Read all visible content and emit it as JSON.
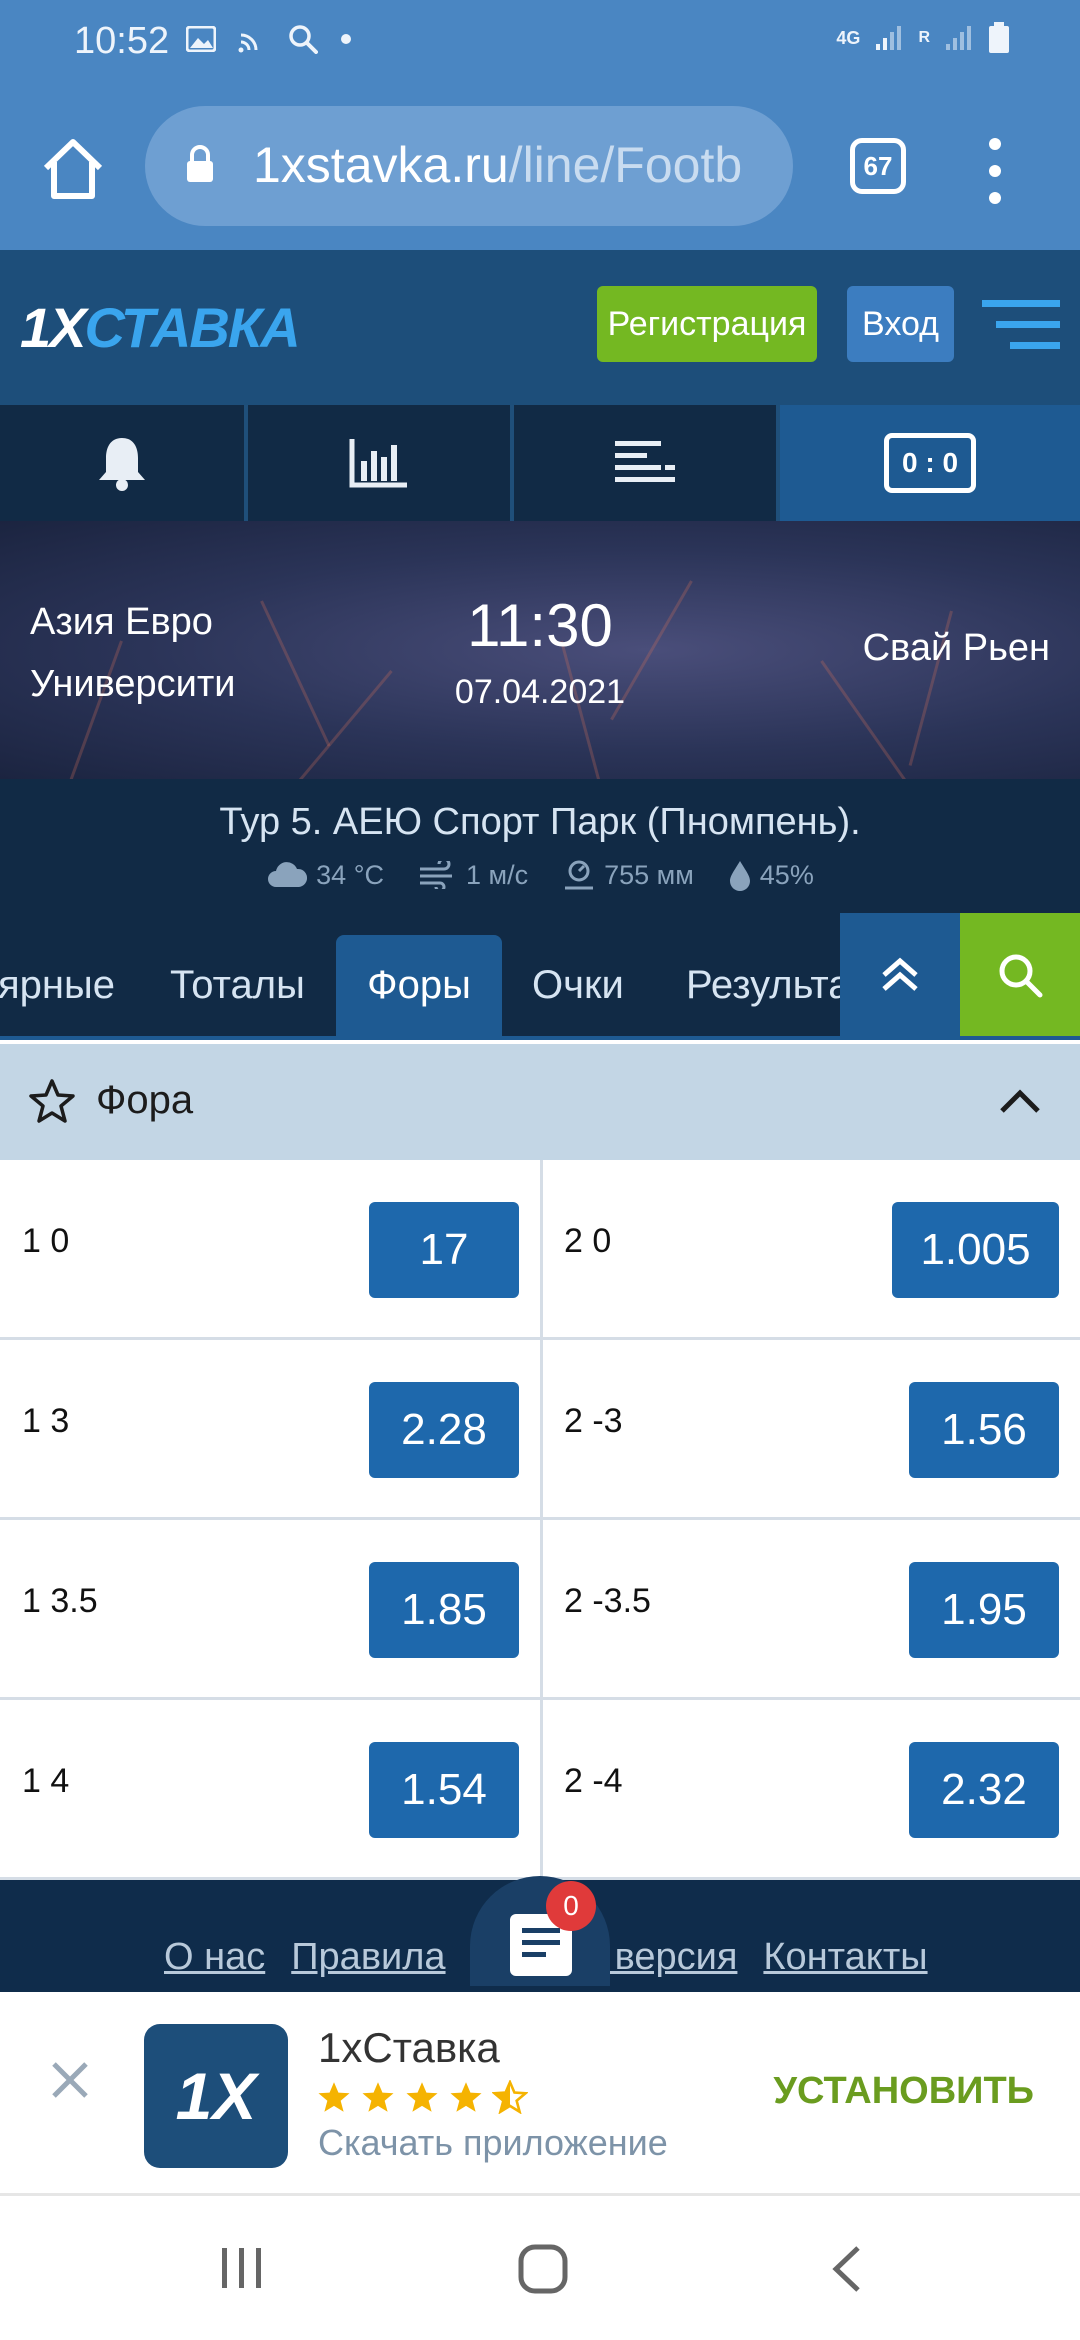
{
  "status_bar": {
    "time": "10:52",
    "network_label": "4G",
    "roaming_label": "R"
  },
  "browser": {
    "url_host": "1xstavka.ru",
    "url_path": "/line/Footb",
    "tabs_count": "67"
  },
  "site": {
    "logo_main": "1X",
    "logo_accent": "СТАВКА",
    "register_label": "Регистрация",
    "login_label": "Вход"
  },
  "nav_tabs": [
    {
      "icon": "bell-icon",
      "active": false
    },
    {
      "icon": "stats-chart-icon",
      "active": false
    },
    {
      "icon": "list-menu-icon",
      "active": false
    },
    {
      "icon": "scoreboard-icon",
      "label": "0 : 0",
      "active": true
    }
  ],
  "match": {
    "team1": "Азия Евро Университи",
    "team2": "Свай Рьен",
    "time": "11:30",
    "date": "07.04.2021",
    "venue": "Тур 5. АЕЮ Спорт Парк (Пномпень).",
    "weather": {
      "temperature": "34 °C",
      "wind": "1 м/с",
      "pressure": "755 мм",
      "humidity": "45%"
    }
  },
  "market_tabs": [
    {
      "label": "ярные",
      "active": false
    },
    {
      "label": "Тоталы",
      "active": false
    },
    {
      "label": "Форы",
      "active": true
    },
    {
      "label": "Очки",
      "active": false
    },
    {
      "label": "Результат",
      "active": false
    }
  ],
  "market": {
    "name": "Фора",
    "rows": [
      {
        "left_label": "1 0",
        "left_coef": "17",
        "right_label": "2 0",
        "right_coef": "1.005"
      },
      {
        "left_label": "1 3",
        "left_coef": "2.28",
        "right_label": "2 -3",
        "right_coef": "1.56"
      },
      {
        "left_label": "1 3.5",
        "left_coef": "1.85",
        "right_label": "2 -3.5",
        "right_coef": "1.95"
      },
      {
        "left_label": "1 4",
        "left_coef": "1.54",
        "right_label": "2 -4",
        "right_coef": "2.32"
      }
    ]
  },
  "footer": {
    "links": [
      "О нас",
      "Правила",
      "Полная версия",
      "Контакты"
    ],
    "coupon_count": "0"
  },
  "app_banner": {
    "icon_text": "1X",
    "name": "1xСтавка",
    "rating": 4.5,
    "subtitle": "Скачать приложение",
    "install_label": "УСТАНОВИТЬ"
  },
  "colors": {
    "browser_blue": "#4a86c2",
    "header_blue": "#1d4e7a",
    "dark_navy": "#112a45",
    "accent_blue": "#1e68ac",
    "green": "#74b822",
    "star_yellow": "#f5b301"
  }
}
